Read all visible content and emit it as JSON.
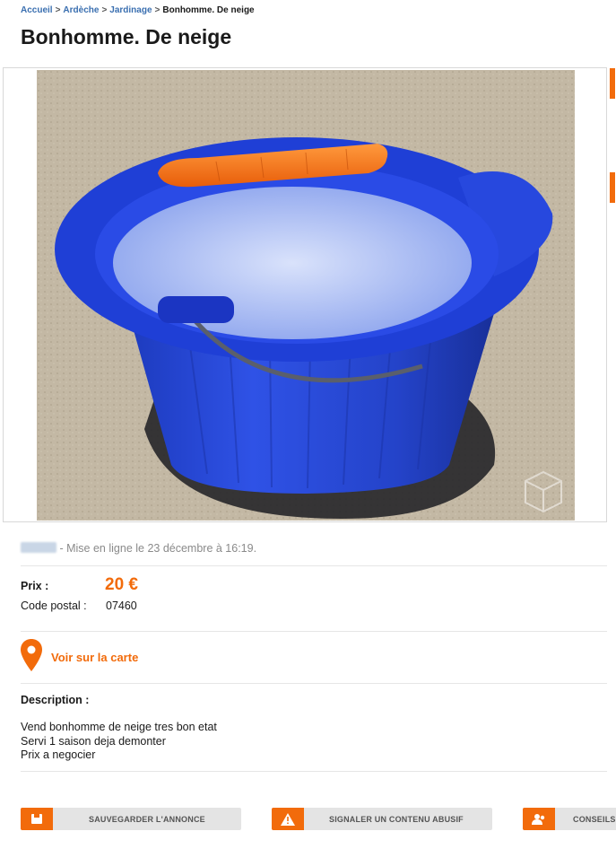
{
  "breadcrumb": {
    "items": [
      "Accueil",
      "Ardèche",
      "Jardinage"
    ],
    "separator": ">",
    "current": "Bonhomme. De neige"
  },
  "title": "Bonhomme. De neige",
  "photo": {
    "watermark": "leboncoin"
  },
  "posted": {
    "text": "- Mise en ligne le 23 décembre à 16:19."
  },
  "details": {
    "price_label": "Prix :",
    "price_value": "20 €",
    "postal_label": "Code postal :",
    "postal_value": "07460"
  },
  "map": {
    "label": "Voir sur la carte",
    "icon": "map-pin-icon"
  },
  "description": {
    "label": "Description :",
    "lines": [
      "Vend bonhomme de neige tres bon etat",
      "Servi 1 saison deja demonter",
      "Prix a negocier"
    ]
  },
  "actions": [
    {
      "label": "SAUVEGARDER L'ANNONCE",
      "icon": "save-icon"
    },
    {
      "label": "SIGNALER UN CONTENU ABUSIF",
      "icon": "warning-icon"
    },
    {
      "label": "CONSEILS",
      "icon": "users-icon"
    }
  ],
  "colors": {
    "accent": "#f26b0b",
    "link": "#3a6fb0"
  }
}
